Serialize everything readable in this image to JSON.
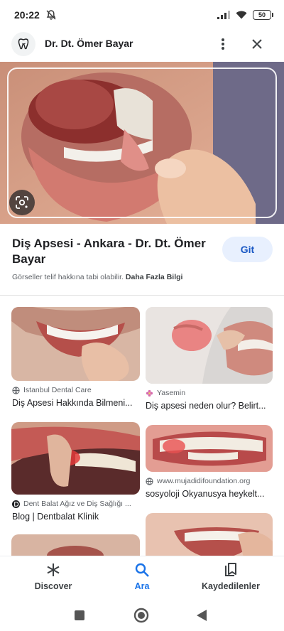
{
  "status_bar": {
    "time": "20:22",
    "battery": "50"
  },
  "header": {
    "site_name": "Dr. Dt. Ömer Bayar"
  },
  "result": {
    "title": "Diş Apsesi - Ankara - Dr. Dt. Ömer Bayar",
    "go_label": "Git",
    "copyright_text": "Görseller telif hakkına tabi olabilir.",
    "more_info_link": "Daha Fazla Bilgi"
  },
  "related": [
    {
      "source": "Istanbul Dental Care",
      "source_icon": "globe-icon",
      "title": "Diş Apsesi Hakkında Bilmeni..."
    },
    {
      "source": "Yasemin",
      "source_icon": "flower-icon",
      "title": "Diş apsesi neden olur? Belirt..."
    },
    {
      "source": "Dent Balat Ağız ve Diş Sağlığı ...",
      "source_icon": "dentbalat-logo-icon",
      "title": "Blog | Dentbalat Klinik"
    },
    {
      "source": "www.mujadidifoundation.org",
      "source_icon": "globe-icon",
      "title": "sosyoloji Okyanusya heykelt..."
    }
  ],
  "bottom_nav": {
    "discover": "Discover",
    "search": "Ara",
    "saved": "Kaydedilenler"
  },
  "colors": {
    "accent": "#1a73e8",
    "go_bg": "#e8f0fe"
  }
}
